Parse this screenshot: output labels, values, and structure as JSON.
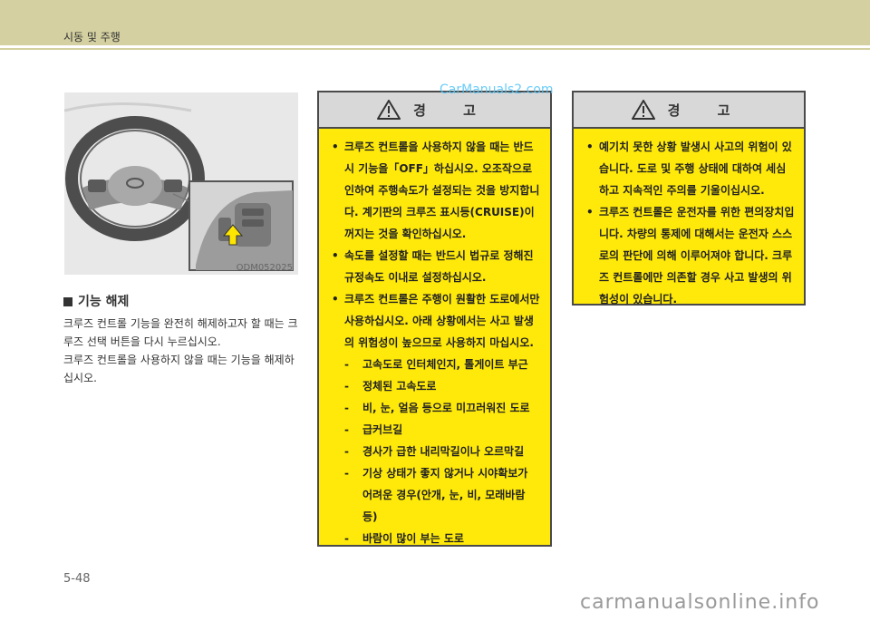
{
  "header": {
    "title": "시동 및 주행"
  },
  "photo": {
    "code": "ODM052025"
  },
  "section": {
    "title": "기능 해제",
    "paragraphs": [
      "크루즈 컨트롤 기능을 완전히 해제하고자 할 때는 크루즈 선택 버튼을 다시 누르십시오.",
      "크루즈 컨트롤을 사용하지 않을 때는 기능을 해제하십시오."
    ]
  },
  "warning1": {
    "title": "경 고",
    "bullets": [
      "크루즈 컨트롤을 사용하지 않을 때는 반드시 기능을「OFF」하십시오. 오조작으로 인하여 주행속도가 설정되는 것을 방지합니다. 계기판의 크루즈 표시등(CRUISE)이 꺼지는 것을 확인하십시오.",
      "속도를 설정할 때는 반드시 법규로 정해진 규정속도 이내로 설정하십시오.",
      "크루즈 컨트롤은 주행이 원활한 도로에서만 사용하십시오. 아래 상황에서는 사고 발생의 위험성이 높으므로 사용하지 마십시오."
    ],
    "dashes": [
      "고속도로 인터체인지, 톨게이트 부근",
      "정체된 고속도로",
      "비, 눈, 얼음 등으로 미끄러워진 도로",
      "급커브길",
      "경사가 급한 내리막길이나 오르막길",
      "기상 상태가 좋지 않거나 시야확보가 어려운 경우(안개, 눈, 비, 모래바람 등)",
      "바람이 많이 부는 도로"
    ]
  },
  "warning2": {
    "title": "경 고",
    "bullets": [
      "예기치 못한 상황 발생시 사고의 위험이 있습니다. 도로 및 주행 상태에 대하여 세심하고 지속적인 주의를 기울이십시오.",
      "크루즈 컨트롤은 운전자를 위한 편의장치입니다. 차량의 통제에 대해서는 운전자 스스로의 판단에 의해 이루어져야 합니다. 크루즈 컨트롤에만 의존할 경우 사고 발생의 위험성이 있습니다."
    ]
  },
  "watermark": "CarManuals2.com",
  "page_number": "5-48",
  "footer_watermark": "carmanualsonline.info",
  "colors": {
    "header_band": "#d4d0a1",
    "warning_fill": "#ffe90a",
    "warning_head": "#d8d8d8",
    "watermark": "#4fc3f7"
  }
}
